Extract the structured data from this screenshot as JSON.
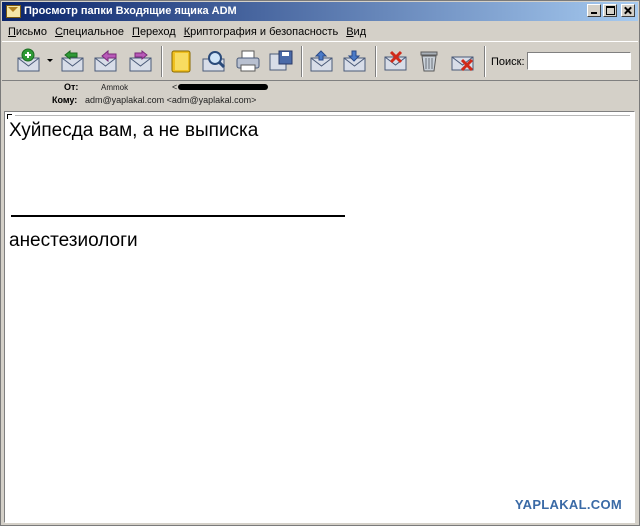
{
  "window": {
    "title": "Просмотр папки Входящие ящика ADM"
  },
  "menu": [
    {
      "u": "П",
      "rest": "исьмо"
    },
    {
      "u": "С",
      "rest": "пециальное"
    },
    {
      "u": "П",
      "rest": "ереход"
    },
    {
      "u": "К",
      "rest": "риптография и безопасность"
    },
    {
      "u": "В",
      "rest": "ид"
    }
  ],
  "toolbar": {
    "search_label": "Поиск:",
    "search_value": "",
    "icons": [
      "new-message-icon",
      "reply-icon",
      "reply-all-icon",
      "forward-icon",
      "address-book-icon",
      "find-icon",
      "print-icon",
      "save-icon",
      "previous-message-icon",
      "next-message-icon",
      "mark-spam-icon",
      "trash-icon",
      "delete-icon"
    ]
  },
  "headers": {
    "from_label": "От:",
    "from_name": "Ammok",
    "from_bracket": "<",
    "to_label": "Кому:",
    "to_value": "adm@yaplakal.com <adm@yaplakal.com>"
  },
  "message": {
    "line1": "Хуйпесда вам, а не выписка",
    "line2": "анестезиологи"
  },
  "watermark": "YAPLAKAL.COM",
  "colors": {
    "titlebar_start": "#0a246a",
    "titlebar_end": "#a6caf0",
    "chrome": "#d4d0c8",
    "watermark": "#3a6aa6"
  }
}
